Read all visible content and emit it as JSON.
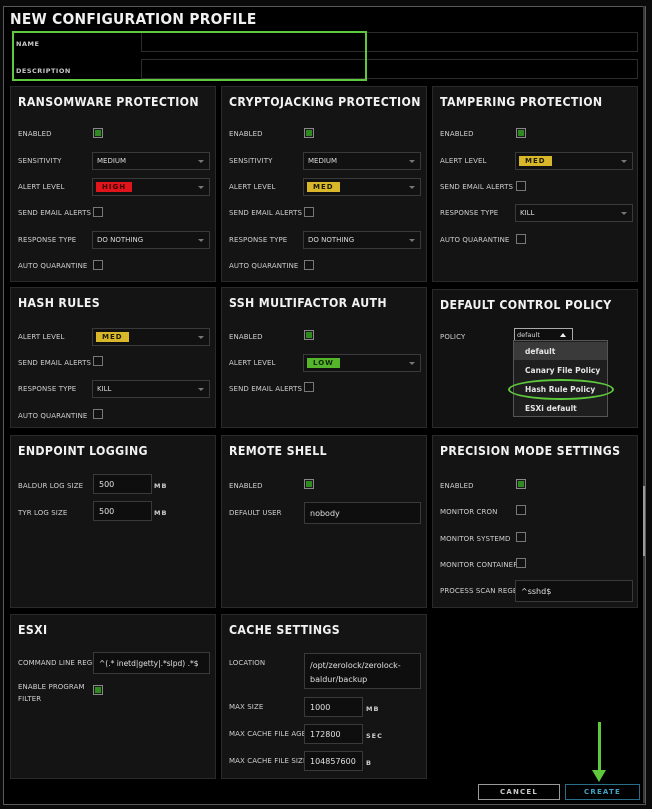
{
  "dialog": {
    "title": "NEW CONFIGURATION PROFILE",
    "name_label": "NAME",
    "name_value": "",
    "description_label": "DESCRIPTION",
    "description_value": ""
  },
  "ransomware": {
    "title": "RANSOMWARE PROTECTION",
    "enabled_label": "ENABLED",
    "enabled": true,
    "sensitivity_label": "SENSITIVITY",
    "sensitivity": "MEDIUM",
    "alert_level_label": "ALERT LEVEL",
    "alert_level": "HIGH",
    "email_label": "SEND EMAIL ALERTS",
    "email": false,
    "response_label": "RESPONSE TYPE",
    "response": "DO NOTHING",
    "quarantine_label": "AUTO QUARANTINE",
    "quarantine": false
  },
  "cryptojacking": {
    "title": "CRYPTOJACKING PROTECTION",
    "enabled_label": "ENABLED",
    "enabled": true,
    "sensitivity_label": "SENSITIVITY",
    "sensitivity": "MEDIUM",
    "alert_level_label": "ALERT LEVEL",
    "alert_level": "MED",
    "email_label": "SEND EMAIL ALERTS",
    "email": false,
    "response_label": "RESPONSE TYPE",
    "response": "DO NOTHING",
    "quarantine_label": "AUTO QUARANTINE",
    "quarantine": false
  },
  "tampering": {
    "title": "TAMPERING PROTECTION",
    "enabled_label": "ENABLED",
    "enabled": true,
    "alert_level_label": "ALERT LEVEL",
    "alert_level": "MED",
    "email_label": "SEND EMAIL ALERTS",
    "email": false,
    "response_label": "RESPONSE TYPE",
    "response": "KILL",
    "quarantine_label": "AUTO QUARANTINE",
    "quarantine": false
  },
  "hash_rules": {
    "title": "HASH RULES",
    "alert_level_label": "ALERT LEVEL",
    "alert_level": "MED",
    "email_label": "SEND EMAIL ALERTS",
    "email": false,
    "response_label": "RESPONSE TYPE",
    "response": "KILL",
    "quarantine_label": "AUTO QUARANTINE",
    "quarantine": false
  },
  "ssh_mfa": {
    "title": "SSH MULTIFACTOR AUTH",
    "enabled_label": "ENABLED",
    "enabled": true,
    "alert_level_label": "ALERT LEVEL",
    "alert_level": "LOW",
    "email_label": "SEND EMAIL ALERTS",
    "email": false
  },
  "default_control_policy": {
    "title": "DEFAULT CONTROL POLICY",
    "policy_label": "POLICY",
    "policy_value": "default",
    "options": [
      "default",
      "Canary File Policy",
      "Hash Rule Policy",
      "ESXi default"
    ],
    "highlighted_option": "Hash Rule Policy"
  },
  "endpoint_logging": {
    "title": "ENDPOINT LOGGING",
    "baldur_label": "BALDUR LOG SIZE",
    "baldur_value": "500",
    "baldur_unit": "MB",
    "tyr_label": "TYR LOG SIZE",
    "tyr_value": "500",
    "tyr_unit": "MB"
  },
  "remote_shell": {
    "title": "REMOTE SHELL",
    "enabled_label": "ENABLED",
    "enabled": true,
    "user_label": "DEFAULT USER",
    "user_value": "nobody"
  },
  "precision_mode": {
    "title": "PRECISION MODE SETTINGS",
    "enabled_label": "ENABLED",
    "enabled": true,
    "cron_label": "MONITOR CRON",
    "cron": false,
    "systemd_label": "MONITOR SYSTEMD",
    "systemd": false,
    "containerd_label": "MONITOR CONTAINERD",
    "containerd": false,
    "regex_label": "PROCESS SCAN REGEX",
    "regex_value": "^sshd$"
  },
  "esxi": {
    "title": "ESXI",
    "cmd_label": "COMMAND LINE REGEX",
    "cmd_value": "^(.* inetd|getty|.*slpd) .*$",
    "filter_label_1": "ENABLE PROGRAM",
    "filter_label_2": "FILTER",
    "filter": true
  },
  "cache": {
    "title": "CACHE SETTINGS",
    "location_label": "LOCATION",
    "location_line1": "/opt/zerolock/zerolock-",
    "location_line2": "baldur/backup",
    "max_size_label": "MAX SIZE",
    "max_size_value": "1000",
    "max_size_unit": "MB",
    "max_age_label": "MAX CACHE FILE AGE",
    "max_age_value": "172800",
    "max_age_unit": "SEC",
    "max_file_label": "MAX CACHE FILE SIZE",
    "max_file_value": "104857600",
    "max_file_unit": "B"
  },
  "footer": {
    "cancel_label": "CANCEL",
    "create_label": "CREATE"
  },
  "colors": {
    "accent_green": "#5ec93c",
    "high": "#e0141b",
    "med": "#d8b82a",
    "low": "#56b62b",
    "create": "#3fa3c4"
  }
}
